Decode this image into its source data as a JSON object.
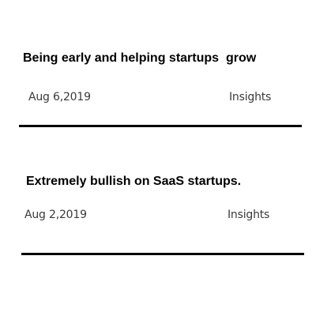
{
  "posts": [
    {
      "title": "Being early and helping startups  grow",
      "date": "Aug 6,2019",
      "category": "Insights"
    },
    {
      "title": "Extremely bullish on SaaS startups.",
      "date": "Aug 2,2019",
      "category": "Insights"
    }
  ]
}
